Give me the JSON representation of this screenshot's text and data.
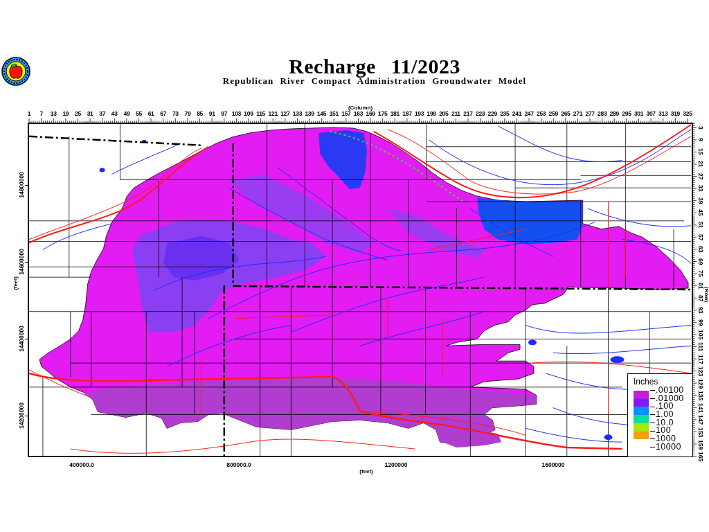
{
  "title": "Recharge 11/2023",
  "subtitle": "Republican River Compact Administration Groundwater Model",
  "column_axis": {
    "title": "(Column)",
    "labels": [
      "1",
      "7",
      "13",
      "19",
      "25",
      "31",
      "37",
      "43",
      "49",
      "55",
      "61",
      "67",
      "73",
      "79",
      "85",
      "91",
      "97",
      "103",
      "109",
      "115",
      "121",
      "127",
      "133",
      "139",
      "145",
      "151",
      "157",
      "163",
      "169",
      "175",
      "181",
      "187",
      "193",
      "199",
      "205",
      "211",
      "217",
      "223",
      "229",
      "235",
      "241",
      "247",
      "253",
      "259",
      "265",
      "271",
      "277",
      "283",
      "289",
      "295",
      "301",
      "307",
      "313",
      "319",
      "325"
    ]
  },
  "y_axis": {
    "title": "(feet)",
    "labels": [
      "14800000",
      "14600000",
      "14400000",
      "14200000"
    ]
  },
  "row_axis": {
    "title": "(Row)",
    "labels": [
      "3",
      "9",
      "15",
      "21",
      "27",
      "33",
      "39",
      "45",
      "51",
      "57",
      "63",
      "69",
      "75",
      "81",
      "87",
      "93",
      "99",
      "105",
      "111",
      "117",
      "123",
      "129",
      "135",
      "141",
      "147",
      "153",
      "159",
      "165"
    ]
  },
  "legend": {
    "title": "Inches",
    "labels": [
      ".00100",
      ".01000",
      ".100",
      "1.00",
      "10.0",
      "100",
      "1000",
      "10000"
    ],
    "bands": [
      {
        "color": "#c020d8"
      },
      {
        "color": "#8018f8"
      },
      {
        "color": "#0090ff"
      },
      {
        "color": "#00e0a0"
      },
      {
        "color": "#a8e800"
      },
      {
        "color": "#f8a000"
      }
    ]
  },
  "x_axis": {
    "labels": [
      "400000.0",
      "800000.0",
      "1200000",
      "1600000"
    ],
    "title": "(feet)"
  }
}
